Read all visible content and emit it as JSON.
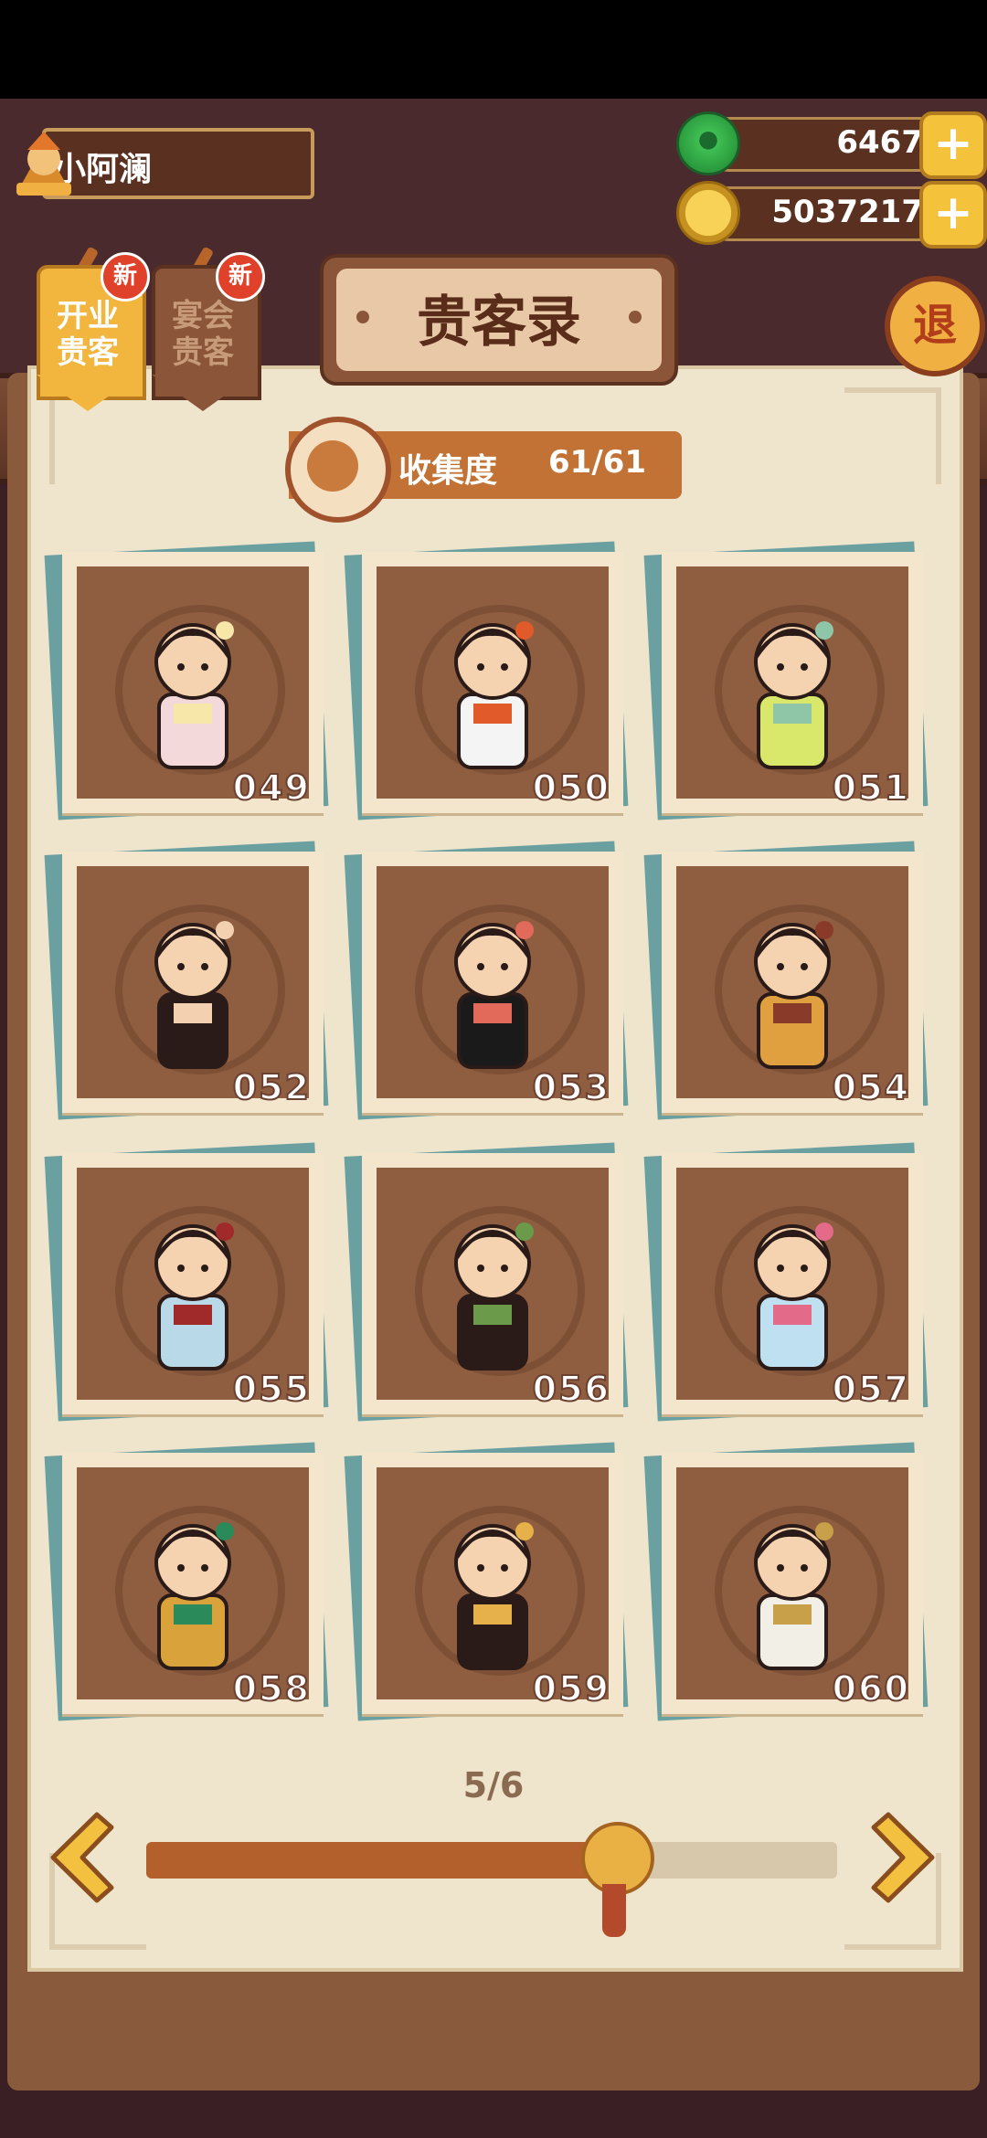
{
  "player": {
    "name": "小阿澜"
  },
  "resources": [
    {
      "icon": "jade-icon",
      "value": "6467"
    },
    {
      "icon": "coin-icon",
      "value": "5037217"
    }
  ],
  "tabs": [
    {
      "line1": "开业",
      "line2": "贵客",
      "badge": "新",
      "active": true
    },
    {
      "line1": "宴会",
      "line2": "贵客",
      "badge": "新",
      "active": false
    }
  ],
  "title": "贵客录",
  "exit_label": "退",
  "collection": {
    "label": "收集度",
    "value": "61/61",
    "progress": 1.0
  },
  "guests": [
    {
      "number": "049",
      "colors": [
        "#2a1a18",
        "#f3d9d9",
        "#f7e7a8"
      ]
    },
    {
      "number": "050",
      "colors": [
        "#3a2f5a",
        "#f4f4f4",
        "#e05a2a"
      ]
    },
    {
      "number": "051",
      "colors": [
        "#2a1a18",
        "#d9e86a",
        "#8fc6a8"
      ]
    },
    {
      "number": "052",
      "colors": [
        "#4a6c8a",
        "#2a1a18",
        "#f3d0b0"
      ]
    },
    {
      "number": "053",
      "colors": [
        "#f4d447",
        "#1a1a1a",
        "#e26a5a"
      ]
    },
    {
      "number": "054",
      "colors": [
        "#2a2a2a",
        "#e0a040",
        "#8a3a28"
      ]
    },
    {
      "number": "055",
      "colors": [
        "#2a4a8a",
        "#b9d9e9",
        "#a02a2a"
      ]
    },
    {
      "number": "056",
      "colors": [
        "#f1e6c8",
        "#2a1a18",
        "#6a9a4a"
      ]
    },
    {
      "number": "057",
      "colors": [
        "#2a1a18",
        "#bfe0f0",
        "#e46a8a"
      ]
    },
    {
      "number": "058",
      "colors": [
        "#2a2a2a",
        "#d9a23a",
        "#2a8a5a"
      ]
    },
    {
      "number": "059",
      "colors": [
        "#c04a2a",
        "#2a1a18",
        "#e6b04a"
      ]
    },
    {
      "number": "060",
      "colors": [
        "#2a7a5a",
        "#f2efe6",
        "#c8a04a"
      ]
    }
  ],
  "pagination": {
    "page_label": "5/6",
    "current": 5,
    "total": 6
  },
  "colors": {
    "accent": "#b4602c",
    "paper": "#efe4cc",
    "card_bg": "#8f5d40"
  }
}
